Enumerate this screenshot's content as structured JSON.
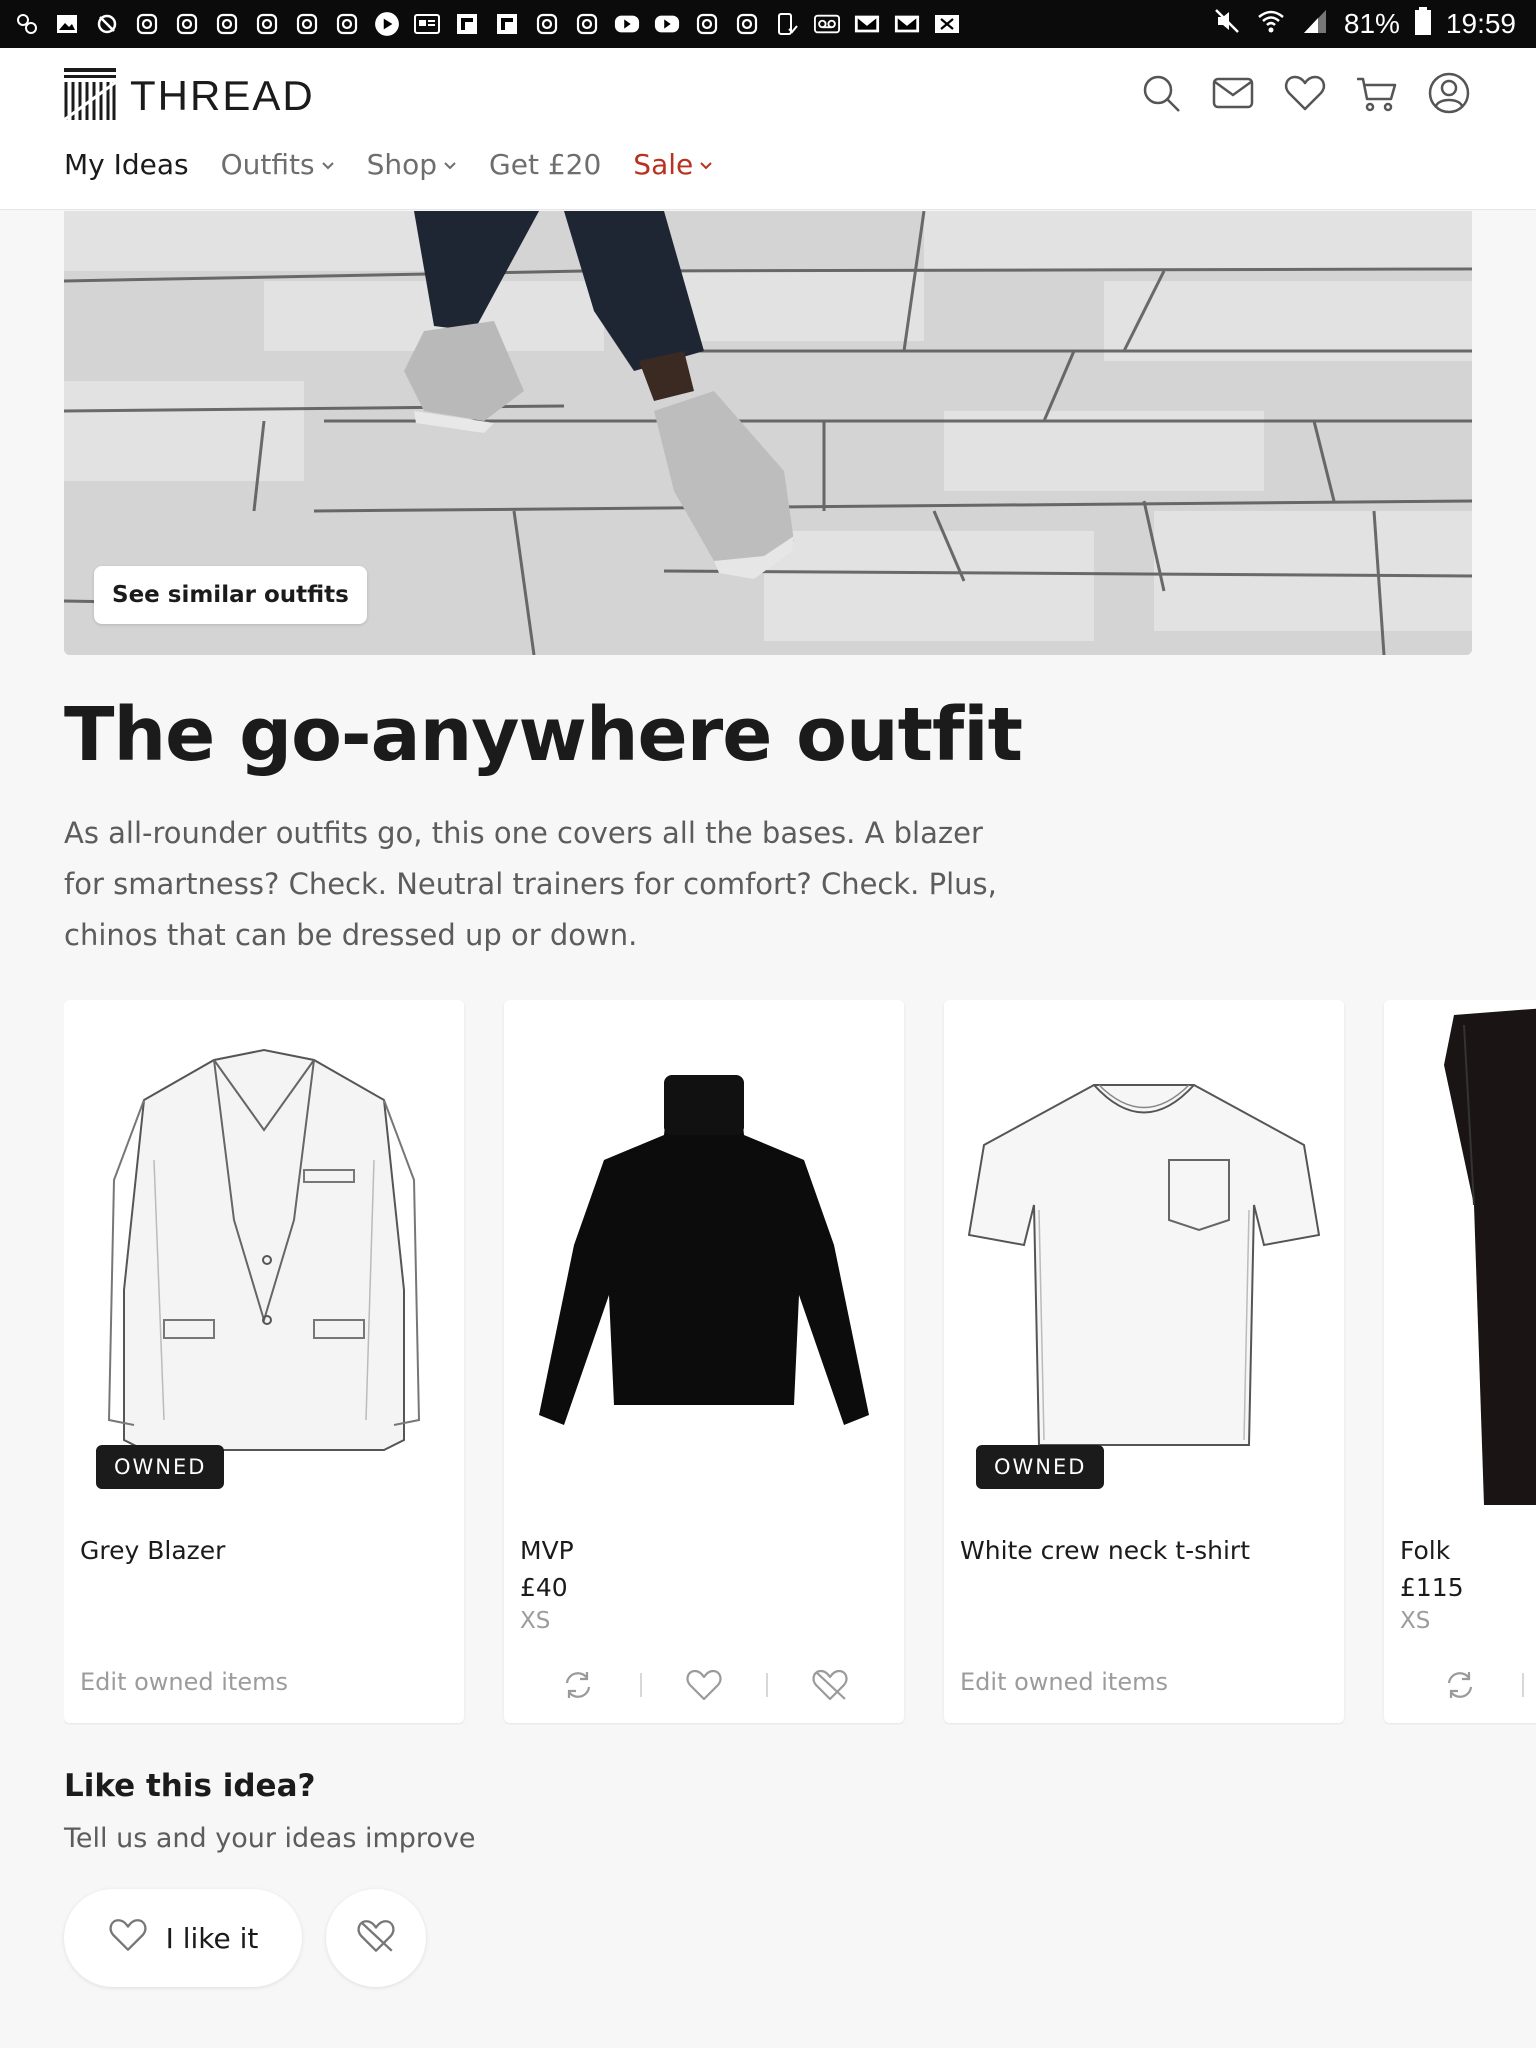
{
  "status_bar": {
    "battery": "81%",
    "time": "19:59",
    "notification_icons": [
      "pinwheel-icon",
      "gallery-icon",
      "cloud-icon",
      "instagram-icon",
      "instagram-icon",
      "instagram-icon",
      "instagram-icon",
      "instagram-icon",
      "instagram-icon",
      "play-icon",
      "news-icon",
      "flipboard-icon",
      "flipboard-icon",
      "instagram-icon",
      "instagram-icon",
      "youtube-icon",
      "youtube-icon",
      "instagram-icon",
      "instagram-icon",
      "phone-check-icon",
      "voicemail-icon",
      "gmail-icon",
      "gmail-icon",
      "mail-x-icon"
    ]
  },
  "header": {
    "brand": "THREAD",
    "icons": [
      "search-icon",
      "mail-icon",
      "heart-icon",
      "cart-icon",
      "account-icon"
    ],
    "nav": [
      {
        "label": "My Ideas"
      },
      {
        "label": "Outfits"
      },
      {
        "label": "Shop"
      },
      {
        "label": "Get £20"
      },
      {
        "label": "Sale"
      }
    ]
  },
  "hero": {
    "similar_button": "See similar outfits"
  },
  "outfit": {
    "title": "The go-anywhere outfit",
    "description": "As all-rounder outfits go, this one covers all the bases. A blazer for smartness? Check. Neutral trainers for comfort? Check. Plus, chinos that can be dressed up or down."
  },
  "products": [
    {
      "name": "Grey Blazer",
      "badge": "OWNED",
      "edit_label": "Edit owned items"
    },
    {
      "name": "MVP",
      "price": "£40",
      "size": "XS"
    },
    {
      "name": "White crew neck t-shirt",
      "badge": "OWNED",
      "edit_label": "Edit owned items"
    },
    {
      "name": "Folk",
      "price": "£115",
      "size": "XS"
    }
  ],
  "feedback": {
    "title": "Like this idea?",
    "subtitle": "Tell us and your ideas improve",
    "like_label": "I like it"
  },
  "colors": {
    "accent_sale": "#b8331f",
    "text": "#1b1b1b",
    "muted": "#9c9c9c",
    "badge_bg": "#1b1b1b"
  }
}
